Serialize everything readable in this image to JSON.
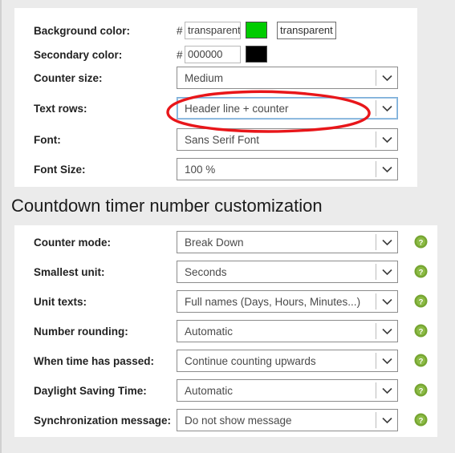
{
  "colors": {
    "accent_green": "#00cc00",
    "black_swatch": "#000000",
    "help_icon_green": "#6aa62f",
    "annotation_red": "#e8161a",
    "focus_blue": "#7aadd9",
    "page_background": "#ebebeb",
    "panel_background": "#ffffff"
  },
  "appearance_panel": {
    "rows": [
      {
        "label": "Background color:",
        "hash": "#",
        "input_value": "transparent",
        "swatch_color": "#00cc00",
        "token": "transparent"
      },
      {
        "label": "Secondary color:",
        "hash": "#",
        "input_value": "000000",
        "swatch_color": "#000000",
        "token": ""
      },
      {
        "label": "Counter size:",
        "value": "Medium"
      },
      {
        "label": "Text rows:",
        "value": "Header line + counter",
        "focused": true,
        "annotated": true
      },
      {
        "label": "Font:",
        "value": "Sans Serif Font"
      },
      {
        "label": "Font Size:",
        "value": "100 %"
      }
    ]
  },
  "numbers_section": {
    "heading": "Countdown timer number customization",
    "rows": [
      {
        "label": "Counter mode:",
        "value": "Break Down",
        "help": "help-icon"
      },
      {
        "label": "Smallest unit:",
        "value": "Seconds",
        "help": "help-icon"
      },
      {
        "label": "Unit texts:",
        "value": "Full names (Days, Hours, Minutes...)",
        "help": "help-icon"
      },
      {
        "label": "Number rounding:",
        "value": "Automatic",
        "help": "help-icon"
      },
      {
        "label": "When time has passed:",
        "value": "Continue counting upwards",
        "help": "help-icon"
      },
      {
        "label": "Daylight Saving Time:",
        "value": "Automatic",
        "help": "help-icon"
      },
      {
        "label": "Synchronization message:",
        "value": "Do not show message",
        "help": "help-icon"
      }
    ]
  },
  "icons": {
    "chevron": "chevron-down-icon",
    "help": "question-mark-help-icon"
  }
}
